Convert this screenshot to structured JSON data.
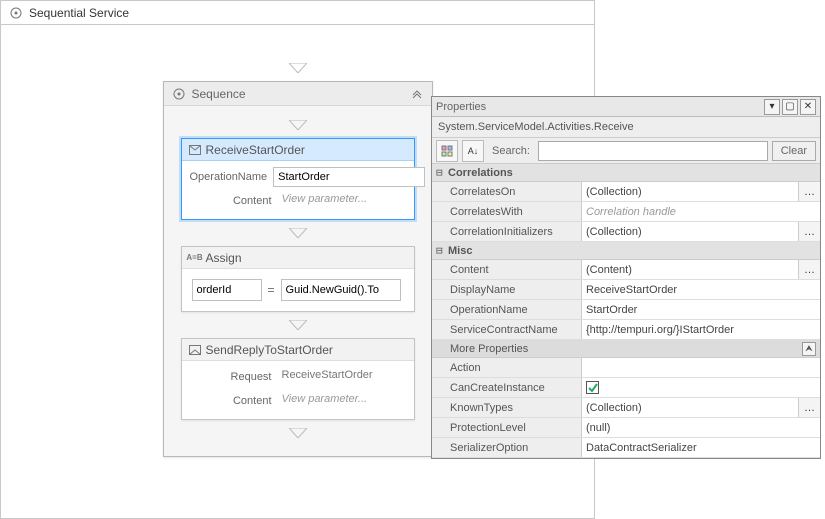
{
  "designer": {
    "root_title": "Sequential Service",
    "sequence": {
      "title": "Sequence",
      "receive": {
        "title": "ReceiveStartOrder",
        "op_label": "OperationName",
        "op_value": "StartOrder",
        "content_label": "Content",
        "content_value": "View parameter..."
      },
      "assign": {
        "title": "Assign",
        "left": "orderId",
        "eq": "=",
        "right": "Guid.NewGuid().To"
      },
      "sendreply": {
        "title": "SendReplyToStartOrder",
        "request_label": "Request",
        "request_value": "ReceiveStartOrder",
        "content_label": "Content",
        "content_value": "View parameter..."
      }
    }
  },
  "properties": {
    "title": "Properties",
    "type_line": "System.ServiceModel.Activities.Receive",
    "search_label": "Search:",
    "search_value": "",
    "clear_label": "Clear",
    "cat_correlations": "Correlations",
    "cat_misc": "Misc",
    "more_label": "More Properties",
    "rows": {
      "correlates_on": {
        "label": "CorrelatesOn",
        "value": "(Collection)"
      },
      "correlates_with": {
        "label": "CorrelatesWith",
        "value": "Correlation handle"
      },
      "correlation_initializers": {
        "label": "CorrelationInitializers",
        "value": "(Collection)"
      },
      "content": {
        "label": "Content",
        "value": "(Content)"
      },
      "display_name": {
        "label": "DisplayName",
        "value": "ReceiveStartOrder"
      },
      "operation_name": {
        "label": "OperationName",
        "value": "StartOrder"
      },
      "service_contract_name": {
        "label": "ServiceContractName",
        "value": "{http://tempuri.org/}IStartOrder"
      },
      "action": {
        "label": "Action",
        "value": ""
      },
      "can_create_instance": {
        "label": "CanCreateInstance",
        "checked": true
      },
      "known_types": {
        "label": "KnownTypes",
        "value": "(Collection)"
      },
      "protection_level": {
        "label": "ProtectionLevel",
        "value": "(null)"
      },
      "serializer_option": {
        "label": "SerializerOption",
        "value": "DataContractSerializer"
      }
    }
  }
}
